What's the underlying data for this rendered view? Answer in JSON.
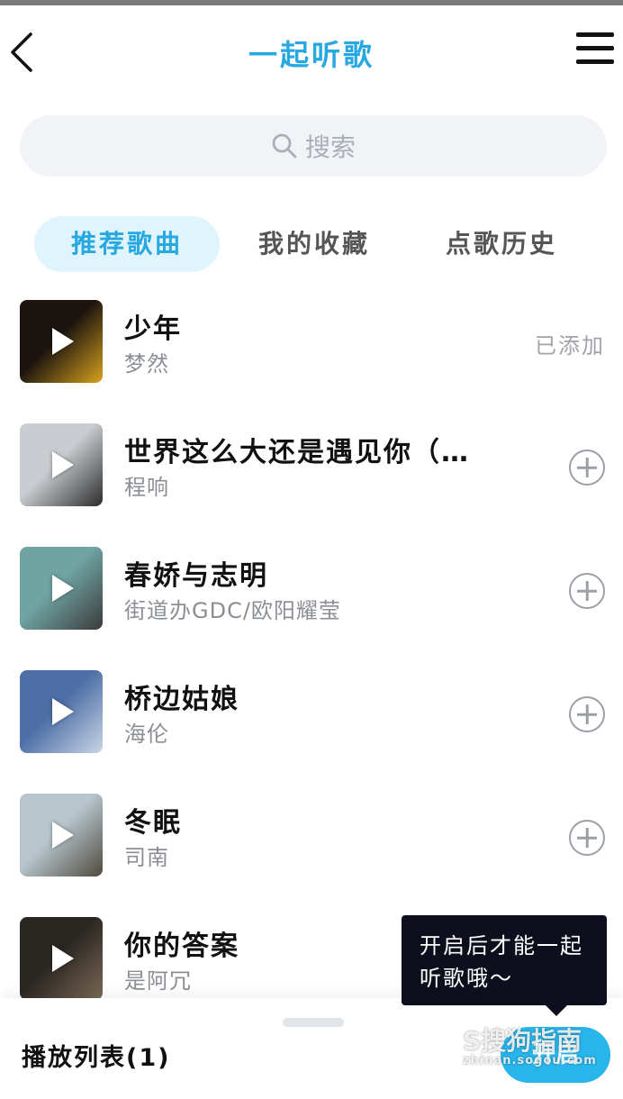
{
  "header": {
    "title": "一起听歌"
  },
  "search": {
    "placeholder": "搜索"
  },
  "tabs": [
    {
      "label": "推荐歌曲",
      "active": true
    },
    {
      "label": "我的收藏",
      "active": false
    },
    {
      "label": "点歌历史",
      "active": false
    }
  ],
  "songs": [
    {
      "title": "少年",
      "artist": "梦然",
      "status": "已添加",
      "cover_colors": [
        "#1b1410",
        "#d8a21e"
      ]
    },
    {
      "title": "世界这么大还是遇见你（…",
      "artist": "程响",
      "status": "",
      "cover_colors": [
        "#c9ccd0",
        "#2b2b2b"
      ]
    },
    {
      "title": "春娇与志明",
      "artist": "街道办GDC/欧阳耀莹",
      "status": "",
      "cover_colors": [
        "#6fa4a3",
        "#3a3a3a"
      ]
    },
    {
      "title": "桥边姑娘",
      "artist": "海伦",
      "status": "",
      "cover_colors": [
        "#4e6fa6",
        "#c9d5e6"
      ]
    },
    {
      "title": "冬眠",
      "artist": "司南",
      "status": "",
      "cover_colors": [
        "#b7c5cc",
        "#4f4a3e"
      ]
    },
    {
      "title": "你的答案",
      "artist": "是阿冗",
      "status": "",
      "cover_colors": [
        "#2a2622",
        "#7b6a55"
      ]
    }
  ],
  "footer": {
    "playlist_label": "播放列表(1)",
    "open_button": "开启"
  },
  "tooltip": {
    "text": "开启后才能一起听歌哦～"
  },
  "watermark": {
    "main": "S搜狗指南",
    "sub": "zhinan.sogou.com"
  },
  "colors": {
    "accent": "#27a8e0",
    "tab_active_bg": "#dff4fb",
    "tooltip_bg": "#0d0f1c"
  }
}
